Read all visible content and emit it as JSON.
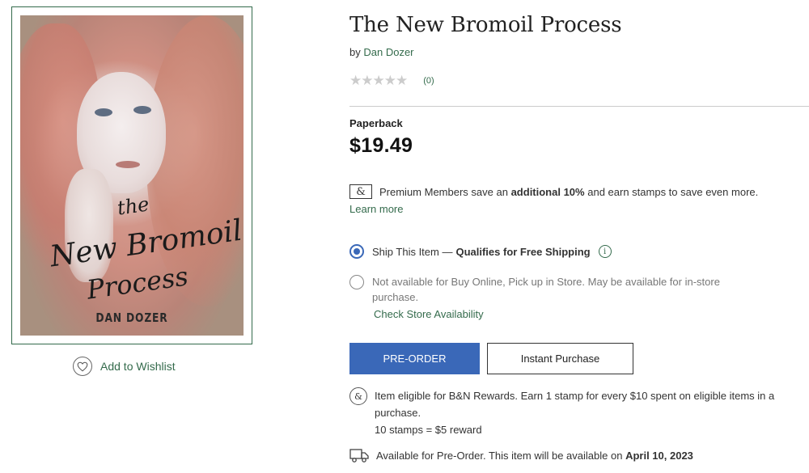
{
  "product": {
    "title": "The New Bromoil Process",
    "by_label": "by",
    "author": "Dan Dozer",
    "rating_stars": "★★★★★",
    "rating_count": "(0)",
    "format": "Paperback",
    "price": "$19.49"
  },
  "cover": {
    "script_the": "the",
    "script_new": "New Bromoil",
    "script_process": "Process",
    "author": "DAN DOZER"
  },
  "wishlist": {
    "label": "Add to Wishlist"
  },
  "premium": {
    "icon": "&",
    "text_before": "Premium Members save an",
    "text_bold": "additional 10%",
    "text_after": "and earn stamps to save even more.",
    "learn_more": "Learn more"
  },
  "shipping": {
    "ship_label": "Ship This Item —",
    "ship_bold": "Qualifies for Free Shipping",
    "info_icon": "i",
    "pickup_text": "Not available for Buy Online, Pick up in Store. May be available for in-store purchase.",
    "check_store": "Check Store Availability"
  },
  "buttons": {
    "preorder": "PRE-ORDER",
    "instant": "Instant Purchase"
  },
  "rewards": {
    "icon": "&",
    "line1": "Item eligible for B&N Rewards. Earn 1 stamp for every $10 spent on eligible items in a purchase.",
    "line2": "10 stamps = $5 reward"
  },
  "preorder_note": {
    "text": "Available for Pre-Order. This item will be available on",
    "date": "April 10, 2023"
  },
  "colors": {
    "link_green": "#346b4c",
    "button_blue": "#3a68b8",
    "star_gray": "#cccccc"
  },
  "icons": [
    "heart-icon",
    "ampersand-icon",
    "info-icon",
    "truck-icon"
  ]
}
